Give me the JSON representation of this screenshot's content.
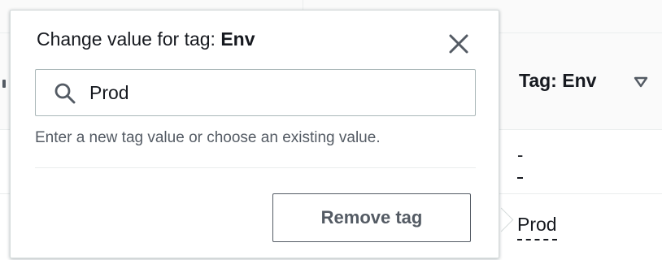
{
  "table": {
    "column_header": "Tag: Env",
    "sort_icon": "caret-down-outline-icon",
    "rows": [
      {
        "value": "-"
      },
      {
        "value": "Prod"
      }
    ]
  },
  "popover": {
    "title_prefix": "Change value for tag: ",
    "title_key": "Env",
    "close_icon": "close-icon",
    "search": {
      "icon": "search-icon",
      "value": "Prod",
      "placeholder": ""
    },
    "hint": "Enter a new tag value or choose an existing value.",
    "remove_label": "Remove tag"
  },
  "colors": {
    "text": "#16191f",
    "secondary_text": "#545b64",
    "border": "#aab7b8",
    "divider": "#eaeded"
  }
}
